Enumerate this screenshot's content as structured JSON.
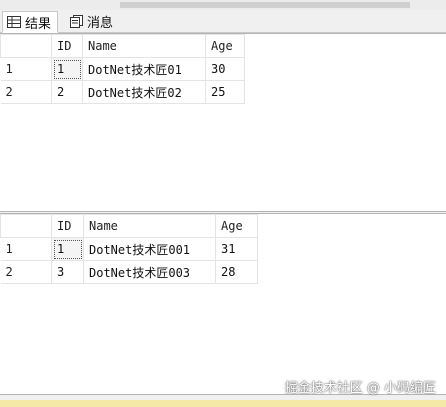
{
  "tabs": [
    {
      "label": "结果",
      "icon": "grid-icon",
      "active": true
    },
    {
      "label": "消息",
      "icon": "messages-icon",
      "active": false
    }
  ],
  "result_sets": [
    {
      "columns": [
        "ID",
        "Name",
        "Age"
      ],
      "rows": [
        {
          "num": "1",
          "id": "1",
          "name": "DotNet技术匠01",
          "age": "30"
        },
        {
          "num": "2",
          "id": "2",
          "name": "DotNet技术匠02",
          "age": "25"
        }
      ]
    },
    {
      "columns": [
        "ID",
        "Name",
        "Age"
      ],
      "rows": [
        {
          "num": "1",
          "id": "1",
          "name": "DotNet技术匠001",
          "age": "31"
        },
        {
          "num": "2",
          "id": "3",
          "name": "DotNet技术匠003",
          "age": "28"
        }
      ]
    }
  ],
  "watermark": "掘金技术社区 @ 小码编匠"
}
